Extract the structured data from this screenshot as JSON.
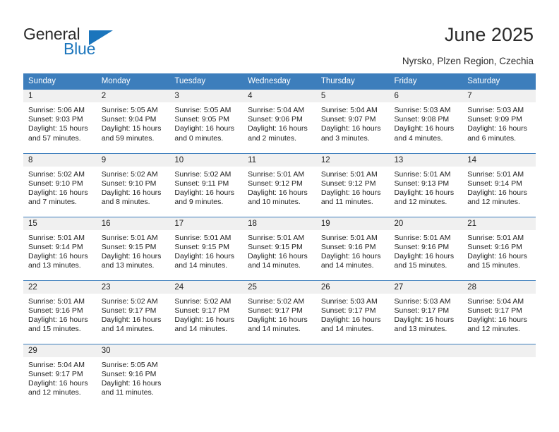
{
  "brand": {
    "name_part1": "General",
    "name_part2": "Blue",
    "accent_color": "#1b75bc",
    "triangle_icon": "triangle-icon"
  },
  "header": {
    "title": "June 2025",
    "subtitle": "Nyrsko, Plzen Region, Czechia"
  },
  "calendar": {
    "header_bg": "#3d7ebc",
    "daynum_bg": "#f0f0f0",
    "weekday_labels": [
      "Sunday",
      "Monday",
      "Tuesday",
      "Wednesday",
      "Thursday",
      "Friday",
      "Saturday"
    ],
    "weeks": [
      [
        {
          "day": "1",
          "sunrise": "Sunrise: 5:06 AM",
          "sunset": "Sunset: 9:03 PM",
          "daylight1": "Daylight: 15 hours",
          "daylight2": "and 57 minutes."
        },
        {
          "day": "2",
          "sunrise": "Sunrise: 5:05 AM",
          "sunset": "Sunset: 9:04 PM",
          "daylight1": "Daylight: 15 hours",
          "daylight2": "and 59 minutes."
        },
        {
          "day": "3",
          "sunrise": "Sunrise: 5:05 AM",
          "sunset": "Sunset: 9:05 PM",
          "daylight1": "Daylight: 16 hours",
          "daylight2": "and 0 minutes."
        },
        {
          "day": "4",
          "sunrise": "Sunrise: 5:04 AM",
          "sunset": "Sunset: 9:06 PM",
          "daylight1": "Daylight: 16 hours",
          "daylight2": "and 2 minutes."
        },
        {
          "day": "5",
          "sunrise": "Sunrise: 5:04 AM",
          "sunset": "Sunset: 9:07 PM",
          "daylight1": "Daylight: 16 hours",
          "daylight2": "and 3 minutes."
        },
        {
          "day": "6",
          "sunrise": "Sunrise: 5:03 AM",
          "sunset": "Sunset: 9:08 PM",
          "daylight1": "Daylight: 16 hours",
          "daylight2": "and 4 minutes."
        },
        {
          "day": "7",
          "sunrise": "Sunrise: 5:03 AM",
          "sunset": "Sunset: 9:09 PM",
          "daylight1": "Daylight: 16 hours",
          "daylight2": "and 6 minutes."
        }
      ],
      [
        {
          "day": "8",
          "sunrise": "Sunrise: 5:02 AM",
          "sunset": "Sunset: 9:10 PM",
          "daylight1": "Daylight: 16 hours",
          "daylight2": "and 7 minutes."
        },
        {
          "day": "9",
          "sunrise": "Sunrise: 5:02 AM",
          "sunset": "Sunset: 9:10 PM",
          "daylight1": "Daylight: 16 hours",
          "daylight2": "and 8 minutes."
        },
        {
          "day": "10",
          "sunrise": "Sunrise: 5:02 AM",
          "sunset": "Sunset: 9:11 PM",
          "daylight1": "Daylight: 16 hours",
          "daylight2": "and 9 minutes."
        },
        {
          "day": "11",
          "sunrise": "Sunrise: 5:01 AM",
          "sunset": "Sunset: 9:12 PM",
          "daylight1": "Daylight: 16 hours",
          "daylight2": "and 10 minutes."
        },
        {
          "day": "12",
          "sunrise": "Sunrise: 5:01 AM",
          "sunset": "Sunset: 9:12 PM",
          "daylight1": "Daylight: 16 hours",
          "daylight2": "and 11 minutes."
        },
        {
          "day": "13",
          "sunrise": "Sunrise: 5:01 AM",
          "sunset": "Sunset: 9:13 PM",
          "daylight1": "Daylight: 16 hours",
          "daylight2": "and 12 minutes."
        },
        {
          "day": "14",
          "sunrise": "Sunrise: 5:01 AM",
          "sunset": "Sunset: 9:14 PM",
          "daylight1": "Daylight: 16 hours",
          "daylight2": "and 12 minutes."
        }
      ],
      [
        {
          "day": "15",
          "sunrise": "Sunrise: 5:01 AM",
          "sunset": "Sunset: 9:14 PM",
          "daylight1": "Daylight: 16 hours",
          "daylight2": "and 13 minutes."
        },
        {
          "day": "16",
          "sunrise": "Sunrise: 5:01 AM",
          "sunset": "Sunset: 9:15 PM",
          "daylight1": "Daylight: 16 hours",
          "daylight2": "and 13 minutes."
        },
        {
          "day": "17",
          "sunrise": "Sunrise: 5:01 AM",
          "sunset": "Sunset: 9:15 PM",
          "daylight1": "Daylight: 16 hours",
          "daylight2": "and 14 minutes."
        },
        {
          "day": "18",
          "sunrise": "Sunrise: 5:01 AM",
          "sunset": "Sunset: 9:15 PM",
          "daylight1": "Daylight: 16 hours",
          "daylight2": "and 14 minutes."
        },
        {
          "day": "19",
          "sunrise": "Sunrise: 5:01 AM",
          "sunset": "Sunset: 9:16 PM",
          "daylight1": "Daylight: 16 hours",
          "daylight2": "and 14 minutes."
        },
        {
          "day": "20",
          "sunrise": "Sunrise: 5:01 AM",
          "sunset": "Sunset: 9:16 PM",
          "daylight1": "Daylight: 16 hours",
          "daylight2": "and 15 minutes."
        },
        {
          "day": "21",
          "sunrise": "Sunrise: 5:01 AM",
          "sunset": "Sunset: 9:16 PM",
          "daylight1": "Daylight: 16 hours",
          "daylight2": "and 15 minutes."
        }
      ],
      [
        {
          "day": "22",
          "sunrise": "Sunrise: 5:01 AM",
          "sunset": "Sunset: 9:16 PM",
          "daylight1": "Daylight: 16 hours",
          "daylight2": "and 15 minutes."
        },
        {
          "day": "23",
          "sunrise": "Sunrise: 5:02 AM",
          "sunset": "Sunset: 9:17 PM",
          "daylight1": "Daylight: 16 hours",
          "daylight2": "and 14 minutes."
        },
        {
          "day": "24",
          "sunrise": "Sunrise: 5:02 AM",
          "sunset": "Sunset: 9:17 PM",
          "daylight1": "Daylight: 16 hours",
          "daylight2": "and 14 minutes."
        },
        {
          "day": "25",
          "sunrise": "Sunrise: 5:02 AM",
          "sunset": "Sunset: 9:17 PM",
          "daylight1": "Daylight: 16 hours",
          "daylight2": "and 14 minutes."
        },
        {
          "day": "26",
          "sunrise": "Sunrise: 5:03 AM",
          "sunset": "Sunset: 9:17 PM",
          "daylight1": "Daylight: 16 hours",
          "daylight2": "and 14 minutes."
        },
        {
          "day": "27",
          "sunrise": "Sunrise: 5:03 AM",
          "sunset": "Sunset: 9:17 PM",
          "daylight1": "Daylight: 16 hours",
          "daylight2": "and 13 minutes."
        },
        {
          "day": "28",
          "sunrise": "Sunrise: 5:04 AM",
          "sunset": "Sunset: 9:17 PM",
          "daylight1": "Daylight: 16 hours",
          "daylight2": "and 12 minutes."
        }
      ],
      [
        {
          "day": "29",
          "sunrise": "Sunrise: 5:04 AM",
          "sunset": "Sunset: 9:17 PM",
          "daylight1": "Daylight: 16 hours",
          "daylight2": "and 12 minutes."
        },
        {
          "day": "30",
          "sunrise": "Sunrise: 5:05 AM",
          "sunset": "Sunset: 9:16 PM",
          "daylight1": "Daylight: 16 hours",
          "daylight2": "and 11 minutes."
        },
        {
          "day": "",
          "sunrise": "",
          "sunset": "",
          "daylight1": "",
          "daylight2": ""
        },
        {
          "day": "",
          "sunrise": "",
          "sunset": "",
          "daylight1": "",
          "daylight2": ""
        },
        {
          "day": "",
          "sunrise": "",
          "sunset": "",
          "daylight1": "",
          "daylight2": ""
        },
        {
          "day": "",
          "sunrise": "",
          "sunset": "",
          "daylight1": "",
          "daylight2": ""
        },
        {
          "day": "",
          "sunrise": "",
          "sunset": "",
          "daylight1": "",
          "daylight2": ""
        }
      ]
    ]
  }
}
